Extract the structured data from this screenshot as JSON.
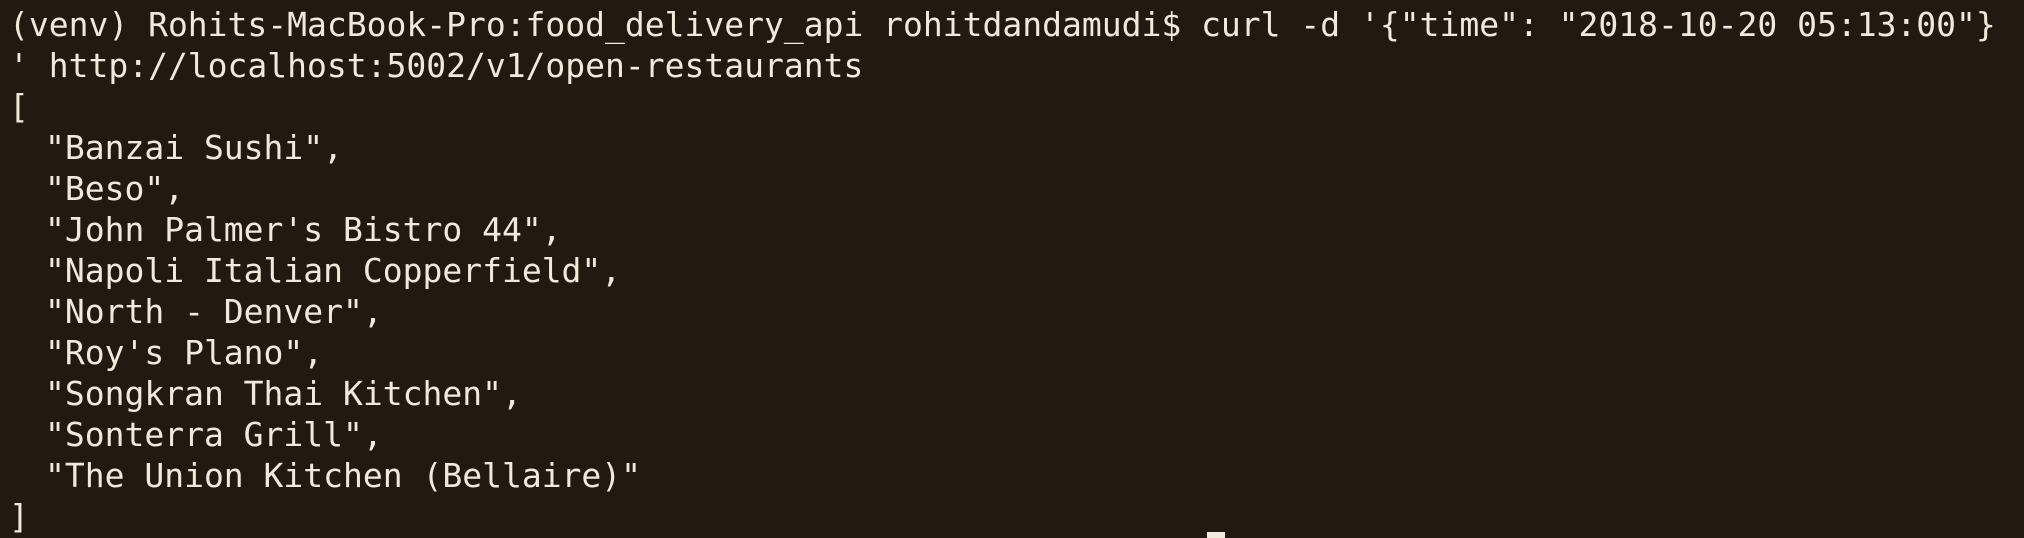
{
  "terminal": {
    "prompt": "(venv) Rohits-MacBook-Pro:food_delivery_api rohitdandamudi$ ",
    "command": "curl -d '{\"time\": \"2018-10-20 05:13:00\"}",
    "command_wrap": "' http://localhost:5002/v1/open-restaurants",
    "open_bracket": "[",
    "items": [
      "\"Banzai Sushi\",",
      "\"Beso\",",
      "\"John Palmer's Bistro 44\",",
      "\"Napoli Italian Copperfield\",",
      "\"North - Denver\",",
      "\"Roy's Plano\",",
      "\"Songkran Thai Kitchen\",",
      "\"Sonterra Grill\",",
      "\"The Union Kitchen (Bellaire)\""
    ],
    "close_bracket": "]"
  },
  "colors": {
    "background": "#221a11",
    "foreground": "#f0e9dc"
  }
}
